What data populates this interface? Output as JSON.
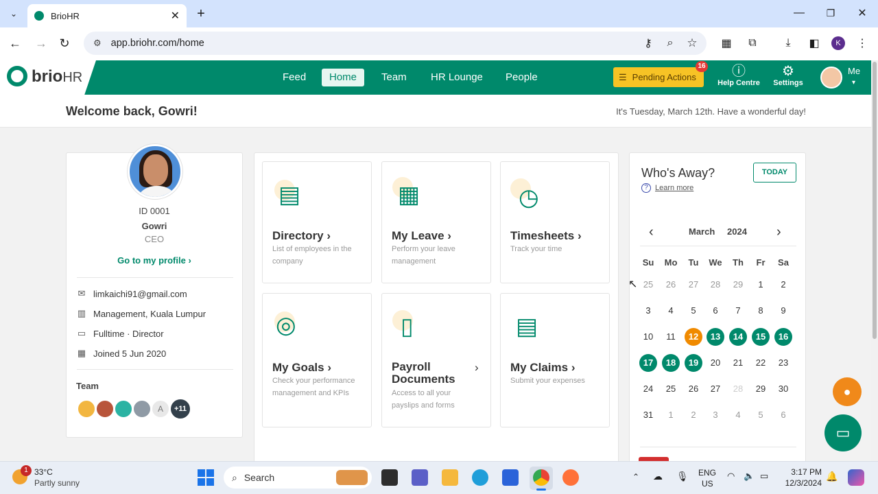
{
  "browser": {
    "tab_title": "BrioHR",
    "url": "app.briohr.com/home",
    "profile_initial": "K"
  },
  "app": {
    "logo_brio": "brio",
    "logo_hr": "HR",
    "nav": [
      "Feed",
      "Home",
      "Team",
      "HR Lounge",
      "People"
    ],
    "active_nav": "Home",
    "pending_actions": "Pending Actions",
    "pending_count": "16",
    "help_label": "Help Centre",
    "settings_label": "Settings",
    "me_label": "Me"
  },
  "welcome": {
    "greeting": "Welcome back, Gowri!",
    "date_message": "It's Tuesday, March 12th. Have a wonderful day!"
  },
  "profile": {
    "id": "ID 0001",
    "name": "Gowri",
    "title": "CEO",
    "profile_link": "Go to my profile",
    "email": "limkaichi91@gmail.com",
    "department": "Management, Kuala Lumpur",
    "employment": "Fulltime · Director",
    "joined": "Joined 5 Jun 2020",
    "team_label": "Team",
    "team_initial": "A",
    "team_more": "+11"
  },
  "tiles": [
    {
      "title": "Directory",
      "sub": "List of employees in the company"
    },
    {
      "title": "My Leave",
      "sub": "Perform your leave management"
    },
    {
      "title": "Timesheets",
      "sub": "Track your time"
    },
    {
      "title": "My Goals",
      "sub": "Check your performance management and KPIs"
    },
    {
      "title": "Payroll Documents",
      "sub": "Access to all your payslips and forms"
    },
    {
      "title": "My Claims",
      "sub": "Submit your expenses"
    }
  ],
  "calendar": {
    "heading": "Who's Away?",
    "today_btn": "TODAY",
    "learn_more": "Learn more",
    "month": "March",
    "year": "2024",
    "weekdays": [
      "Su",
      "Mo",
      "Tu",
      "We",
      "Th",
      "Fr",
      "Sa"
    ],
    "weeks": [
      [
        "25",
        "26",
        "27",
        "28",
        "29",
        "1",
        "2"
      ],
      [
        "3",
        "4",
        "5",
        "6",
        "7",
        "8",
        "9"
      ],
      [
        "10",
        "11",
        "12",
        "13",
        "14",
        "15",
        "16"
      ],
      [
        "17",
        "18",
        "19",
        "20",
        "21",
        "22",
        "23"
      ],
      [
        "24",
        "25",
        "26",
        "27",
        "28",
        "29",
        "30"
      ],
      [
        "31",
        "1",
        "2",
        "3",
        "4",
        "5",
        "6"
      ]
    ],
    "today_date": "12",
    "away_dates": [
      "13",
      "14",
      "15",
      "16",
      "17",
      "18",
      "19"
    ],
    "colors": {
      "accent": "#00896b",
      "today": "#f08a00"
    }
  },
  "taskbar": {
    "weather_temp": "33°C",
    "weather_desc": "Partly sunny",
    "weather_badge": "1",
    "search_placeholder": "Search",
    "lang1": "ENG",
    "lang2": "US",
    "time": "3:17 PM",
    "date": "12/3/2024"
  }
}
